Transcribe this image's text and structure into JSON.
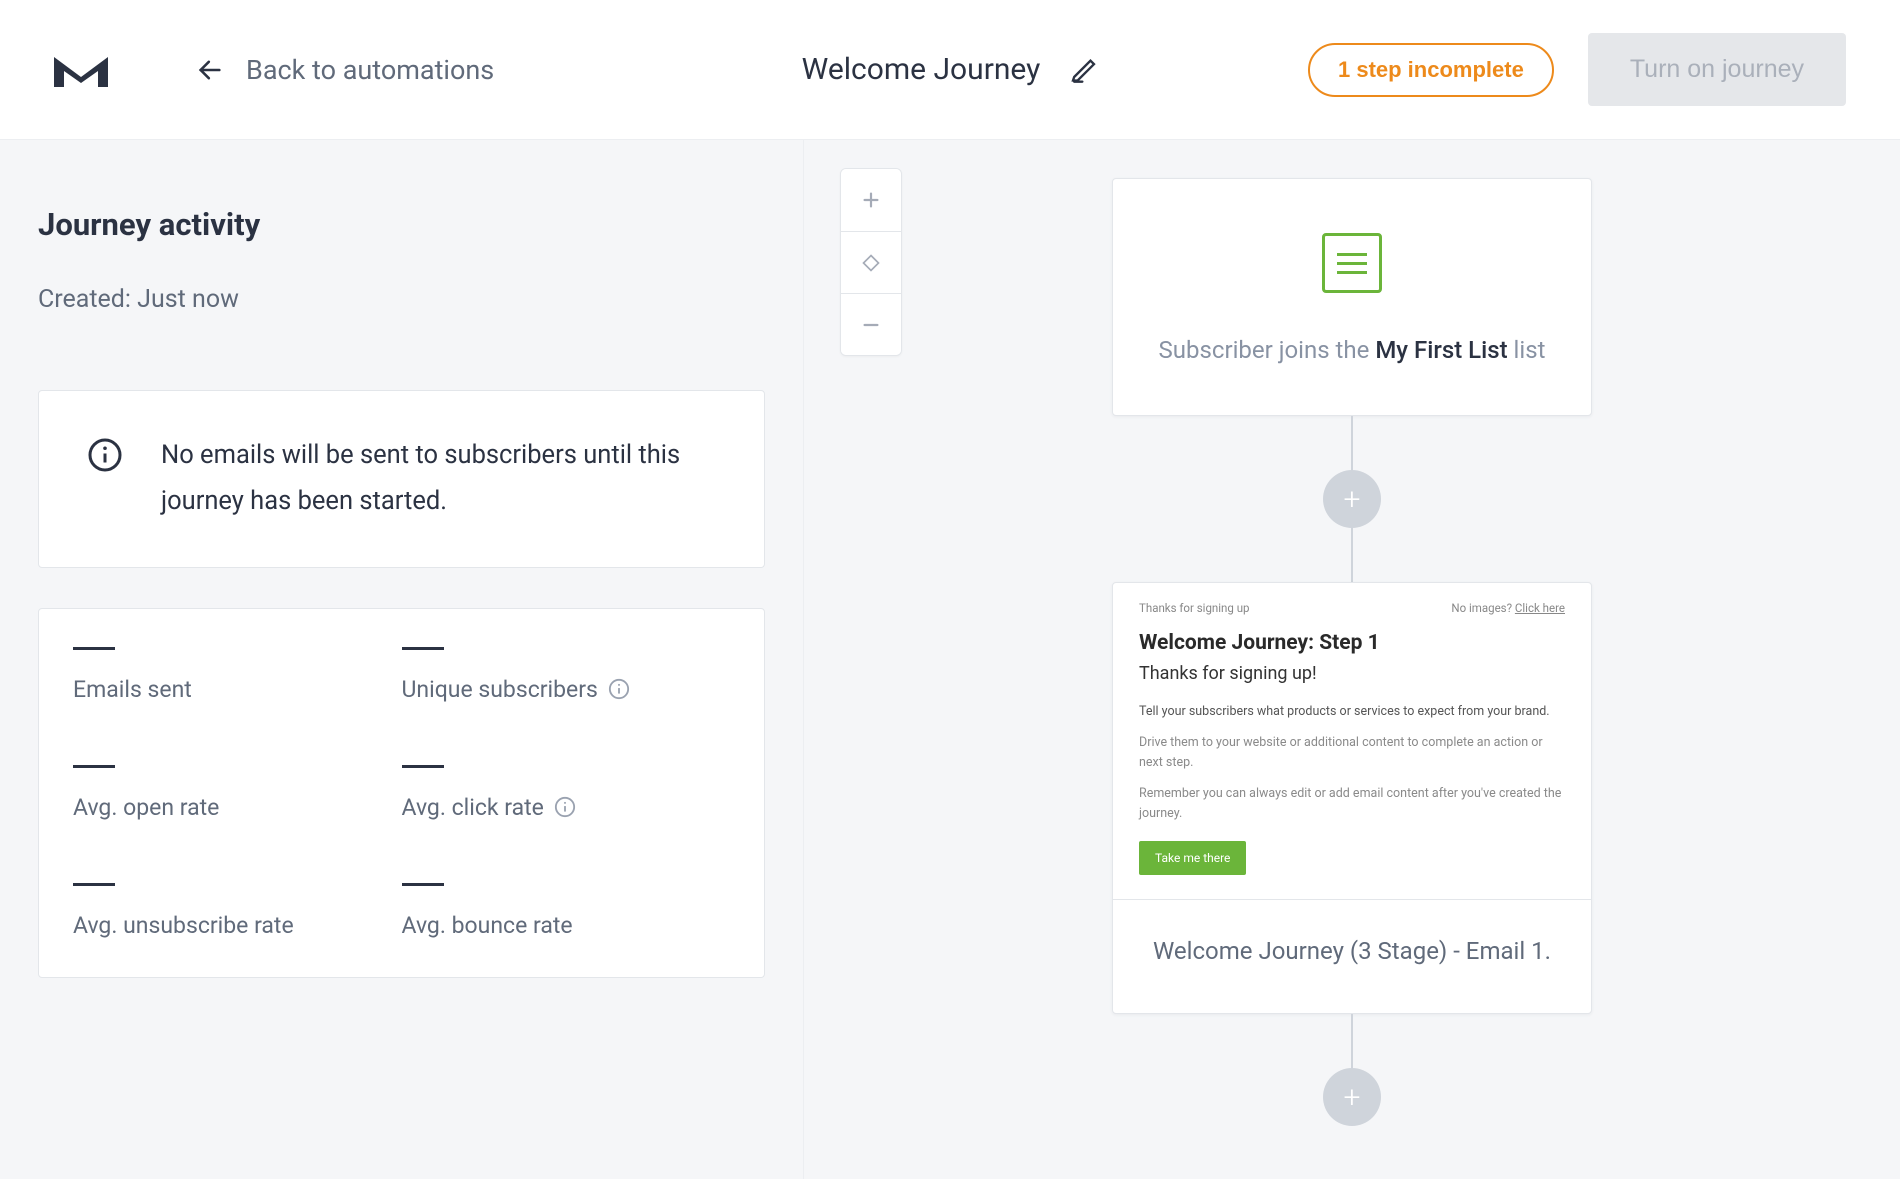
{
  "header": {
    "back_label": "Back to automations",
    "title": "Welcome Journey",
    "incomplete_pill": "1 step incomplete",
    "turn_on_label": "Turn on journey"
  },
  "sidebar": {
    "heading": "Journey activity",
    "created_prefix": "Created: ",
    "created_value": "Just now",
    "info_message": "No emails will be sent to subscribers until this journey has been started.",
    "stats": [
      {
        "label": "Emails sent",
        "value": "—",
        "has_info": false
      },
      {
        "label": "Unique subscribers",
        "value": "—",
        "has_info": true
      },
      {
        "label": "Avg. open rate",
        "value": "—",
        "has_info": false
      },
      {
        "label": "Avg. click rate",
        "value": "—",
        "has_info": true
      },
      {
        "label": "Avg. unsubscribe rate",
        "value": "—",
        "has_info": false
      },
      {
        "label": "Avg. bounce rate",
        "value": "—",
        "has_info": false
      }
    ]
  },
  "canvas": {
    "trigger": {
      "prefix": "Subscriber joins the ",
      "list_name": "My First List",
      "suffix": " list"
    },
    "email1": {
      "preview": {
        "top_left": "Thanks for signing up",
        "top_right_prefix": "No images? ",
        "top_right_link": "Click here",
        "heading": "Welcome Journey: Step 1",
        "subheading": "Thanks for signing up!",
        "body1": "Tell your subscribers what products or services to expect from your brand.",
        "body2": "Drive them to your website or additional content to complete an action or next step.",
        "body3": "Remember you can always edit or add email content after you've created the journey.",
        "cta": "Take me there"
      },
      "footer": "Welcome Journey (3 Stage) - Email 1."
    }
  }
}
